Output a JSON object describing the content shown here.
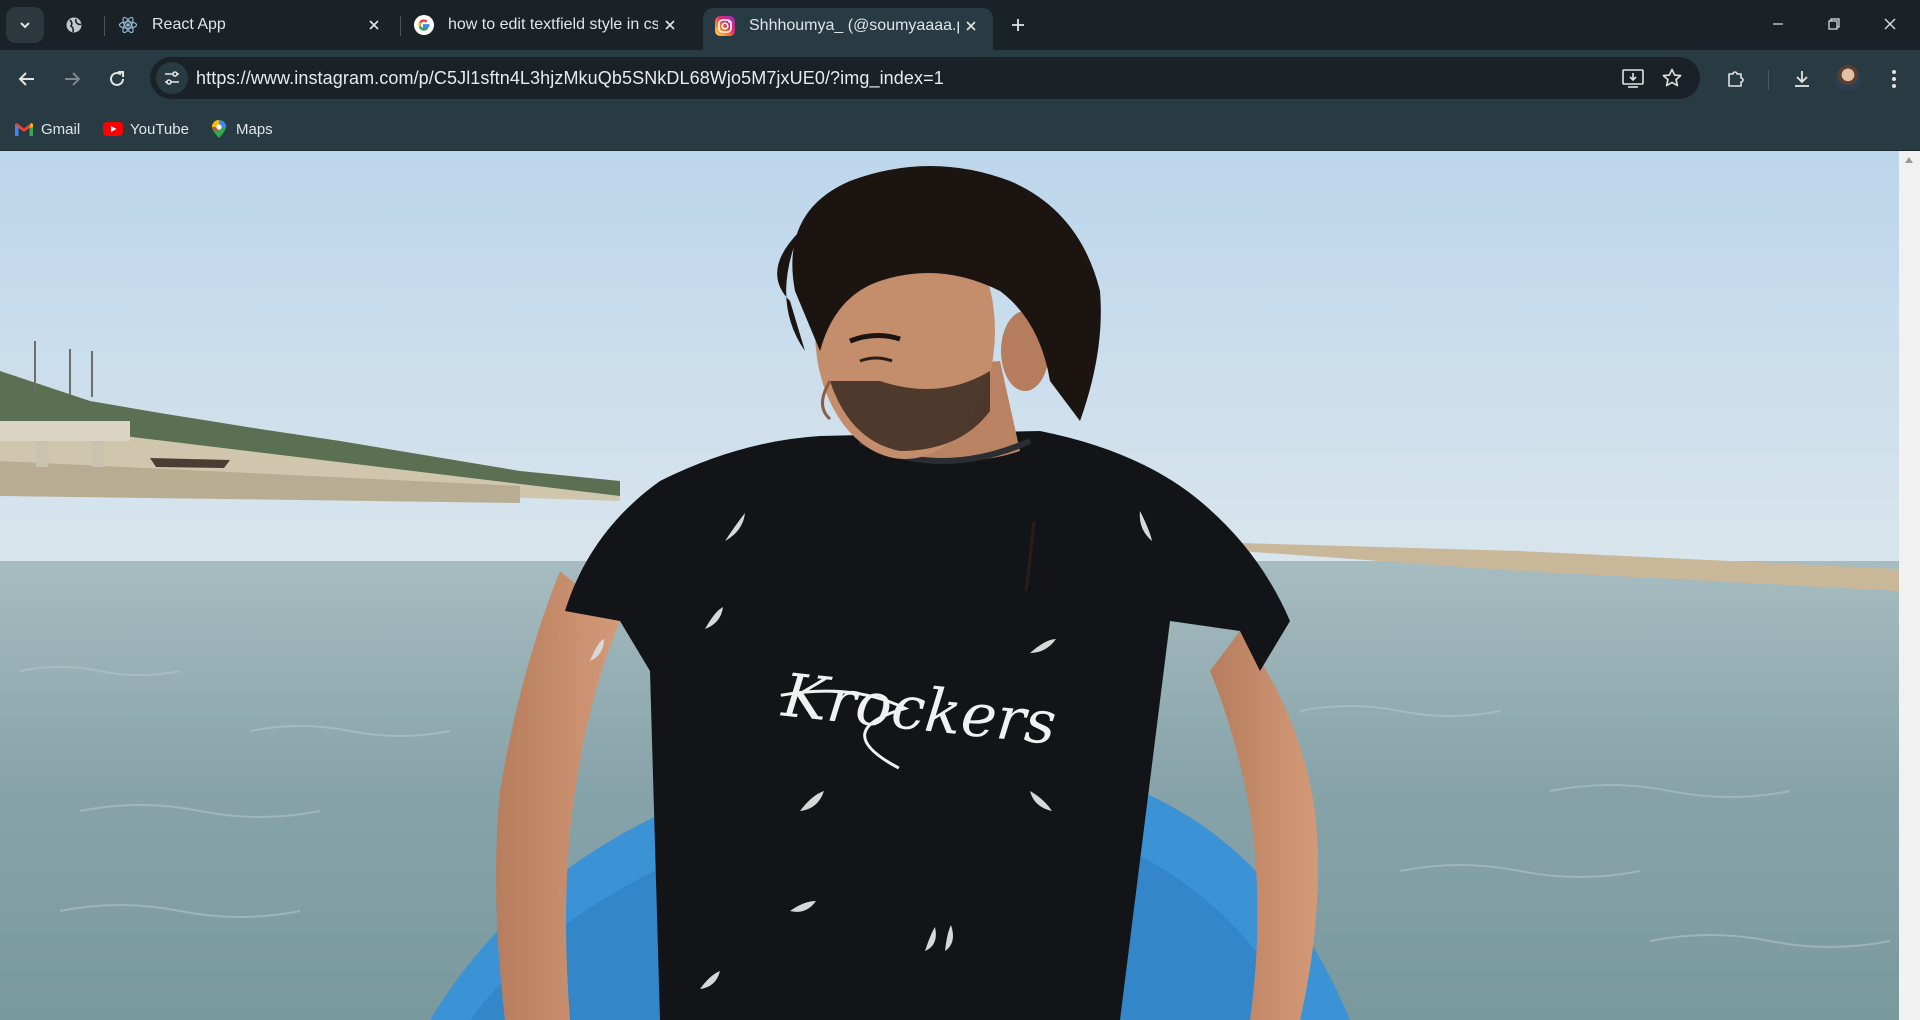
{
  "tabs": [
    {
      "title": "React App",
      "icon": "react-icon"
    },
    {
      "title": "how to edit textfield style in css",
      "icon": "google-icon"
    },
    {
      "title": "Shhhoumya_ (@soumyaaaa.p)",
      "icon": "instagram-icon",
      "active": true
    }
  ],
  "address_bar": {
    "url": "https://www.instagram.com/p/C5Jl1sftn4L3hjzMkuQb5SNkDL68Wjo5M7jxUE0/?img_index=1"
  },
  "bookmarks": [
    {
      "label": "Gmail",
      "icon": "gmail-icon"
    },
    {
      "label": "YouTube",
      "icon": "youtube-icon"
    },
    {
      "label": "Maps",
      "icon": "maps-icon"
    }
  ],
  "photo": {
    "shirt_text": "Krockers"
  },
  "colors": {
    "tabstrip": "#1a2227",
    "toolbar": "#283a42",
    "sky": "#c9dcea",
    "sea": "#7f9ea4",
    "boat": "#3b93d6"
  }
}
